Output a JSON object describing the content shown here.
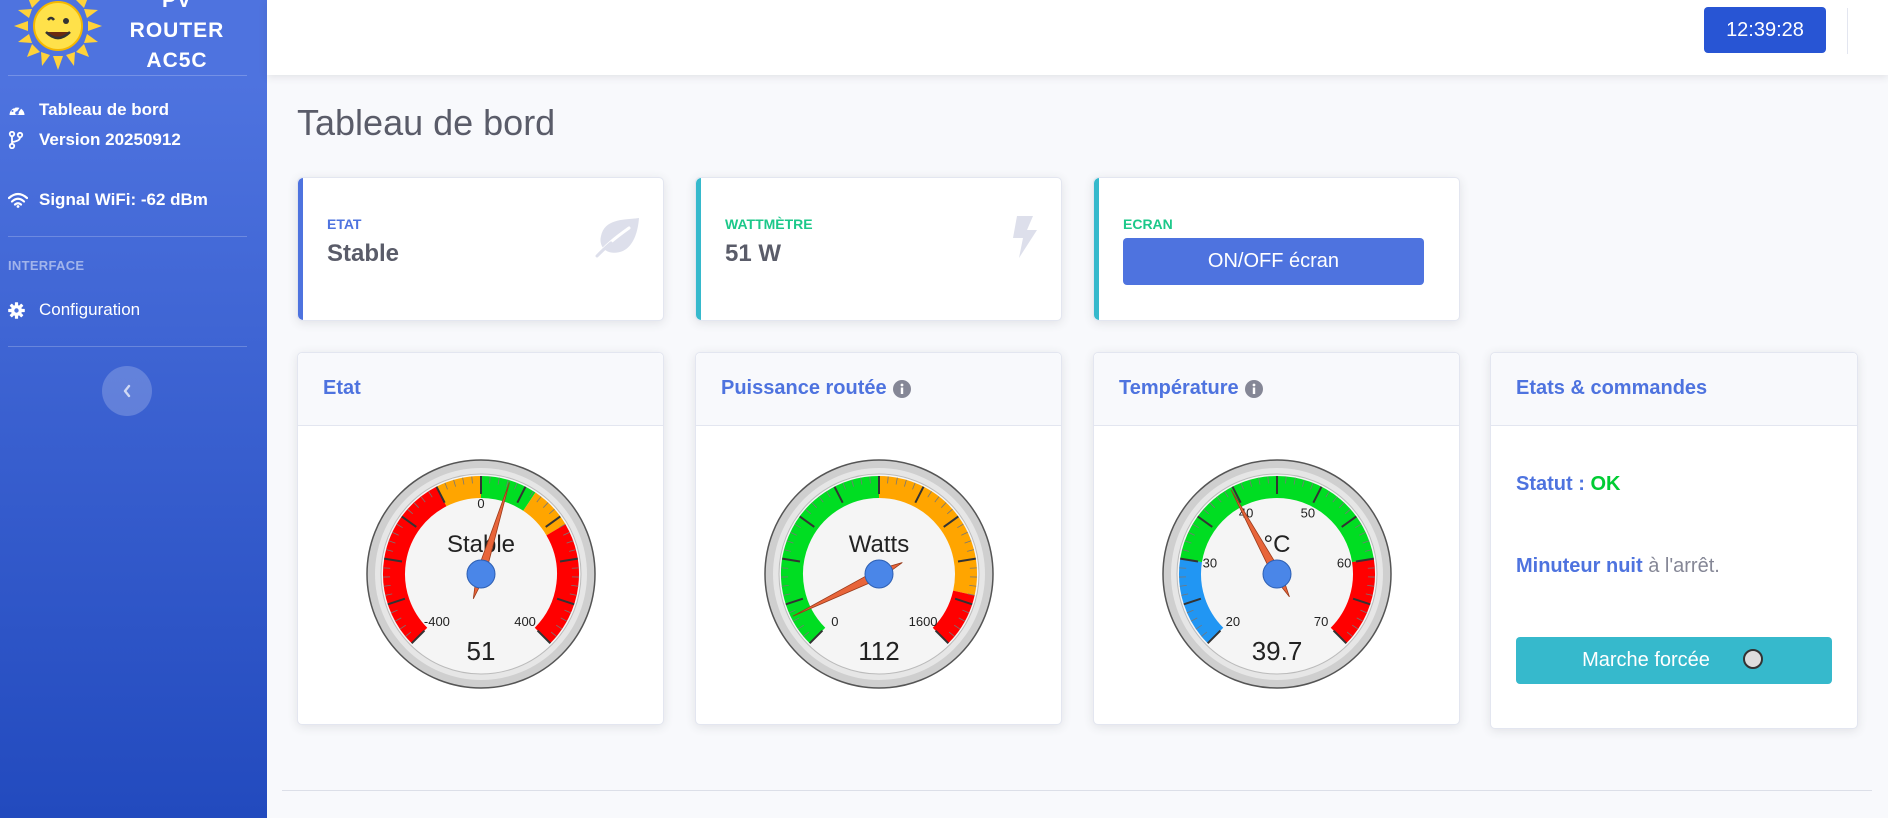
{
  "app": {
    "brand_lines": [
      "PV",
      "ROUTER",
      "AC5C"
    ]
  },
  "topbar": {
    "clock": "12:39:28"
  },
  "sidebar": {
    "items": [
      {
        "label": "Tableau de bord",
        "icon": "tachometer-icon"
      },
      {
        "label": "Version 20250912",
        "icon": "code-branch-icon"
      },
      {
        "label": "Signal WiFi: -62 dBm",
        "icon": "wifi-icon"
      }
    ],
    "heading": "INTERFACE",
    "config": {
      "label": "Configuration",
      "icon": "gear-icon"
    }
  },
  "page": {
    "title": "Tableau de bord"
  },
  "stats": [
    {
      "label": "ETAT",
      "value": "Stable",
      "color": "#4e73df",
      "icon": "leaf-icon"
    },
    {
      "label": "WATTMÈTRE",
      "value": "51 W",
      "color": "#1cc88a",
      "icon": "bolt-icon"
    },
    {
      "label": "ECRAN",
      "button": "ON/OFF écran",
      "color": "#1cc88a",
      "bar_color": "#36b9cc"
    }
  ],
  "gauges": [
    {
      "title": "Etat",
      "unit_label": "Stable",
      "value_text": "51",
      "value": 51,
      "min": -400,
      "max": 400,
      "min_label": "-400",
      "max_label": "400",
      "mid_label": "0",
      "info_icon": false,
      "bands": [
        {
          "from": 0.0,
          "to": 0.4,
          "color": "#ff0000"
        },
        {
          "from": 0.4,
          "to": 0.5,
          "color": "#ffa500"
        },
        {
          "from": 0.5,
          "to": 0.625,
          "color": "#00dd22"
        },
        {
          "from": 0.625,
          "to": 0.72,
          "color": "#ffa500"
        },
        {
          "from": 0.72,
          "to": 1.0,
          "color": "#ff0000"
        }
      ]
    },
    {
      "title": "Puissance routée",
      "unit_label": "Watts",
      "value_text": "112",
      "value": 112,
      "min": 0,
      "max": 1600,
      "min_label": "0",
      "max_label": "1600",
      "info_icon": true,
      "bands": [
        {
          "from": 0.0,
          "to": 0.5,
          "color": "#00dd22"
        },
        {
          "from": 0.5,
          "to": 0.88,
          "color": "#ffa500"
        },
        {
          "from": 0.88,
          "to": 1.0,
          "color": "#ff0000"
        }
      ]
    },
    {
      "title": "Température",
      "unit_label": "°C",
      "value_text": "39.7",
      "value": 39.7,
      "min": 20,
      "max": 70,
      "min_label": "20",
      "max_label": "70",
      "ticks": [
        {
          "value": 30,
          "label": "30"
        },
        {
          "value": 40,
          "label": "40"
        },
        {
          "value": 50,
          "label": "50"
        },
        {
          "value": 60,
          "label": "60"
        }
      ],
      "info_icon": true,
      "bands": [
        {
          "from": 0.0,
          "to": 0.2,
          "color": "#2196f3"
        },
        {
          "from": 0.2,
          "to": 0.8,
          "color": "#00dd22"
        },
        {
          "from": 0.8,
          "to": 1.0,
          "color": "#ff0000"
        }
      ]
    }
  ],
  "commands": {
    "title": "Etats & commandes",
    "statut_label": "Statut :",
    "statut_value": "OK",
    "statut_color": "#00cc33",
    "timer_label": "Minuteur nuit",
    "timer_value": "à l'arrêt.",
    "forced_label": "Marche forcée"
  },
  "colors": {
    "primary": "#4e73df",
    "info": "#36b9cc",
    "success": "#1cc88a",
    "needle": "#e8653a",
    "hub": "#4a86e8"
  }
}
